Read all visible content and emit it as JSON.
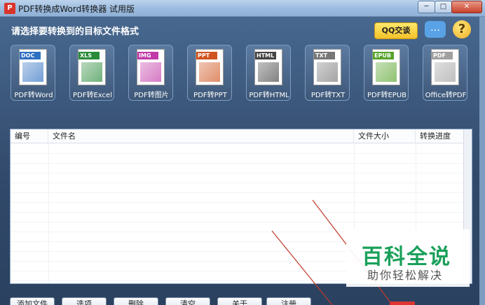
{
  "window": {
    "title": "PDF转换成Word转换器 试用版",
    "app_icon_glyph": "P",
    "min_glyph": "─",
    "max_glyph": "□",
    "close_glyph": "✕"
  },
  "header": {
    "prompt": "请选择要转换到的目标文件格式",
    "qq_label": "QQ交谈",
    "chat_glyph": "…",
    "help_glyph": "?"
  },
  "formats": [
    {
      "badge": "DOC",
      "label": "PDF转Word",
      "color": "#2f6fc1"
    },
    {
      "badge": "XLS",
      "label": "PDF转Excel",
      "color": "#2a8b3a"
    },
    {
      "badge": "IMG",
      "label": "PDF转图片",
      "color": "#c23aa8"
    },
    {
      "badge": "PPT",
      "label": "PDF转PPT",
      "color": "#d0541f"
    },
    {
      "badge": "HTML",
      "label": "PDF转HTML",
      "color": "#444444"
    },
    {
      "badge": "TXT",
      "label": "PDF转TXT",
      "color": "#777777"
    },
    {
      "badge": "EPUB",
      "label": "PDF转EPUB",
      "color": "#57a32b"
    },
    {
      "badge": "PDF",
      "label": "Office转PDF",
      "color": "#a0a0a0"
    }
  ],
  "table": {
    "columns": [
      "编号",
      "文件名",
      "文件大小",
      "转换进度"
    ],
    "rows": []
  },
  "watermark": {
    "title": "百科全说",
    "subtitle": "助你轻松解决"
  },
  "buttons": [
    "添加文件",
    "选项",
    "删除",
    "清空",
    "关于",
    "注册"
  ]
}
